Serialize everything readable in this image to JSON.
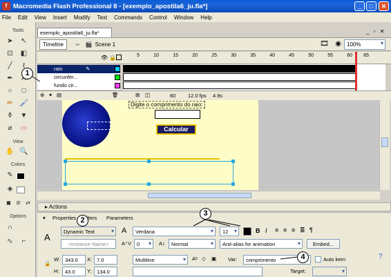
{
  "window": {
    "title": "Macromedia Flash Professional 8 - [exemplo_apostila6_ju.fla*]",
    "min": "_",
    "max": "□",
    "close": "✕"
  },
  "menu": [
    "File",
    "Edit",
    "View",
    "Insert",
    "Modify",
    "Text",
    "Commands",
    "Control",
    "Window",
    "Help"
  ],
  "tools": {
    "title": "Tools",
    "view": "View",
    "colors": "Colors",
    "options": "Options"
  },
  "doc": {
    "tab": "exemplo_apostila6_ju.fla*",
    "timeline_btn": "Timeline",
    "scene": "Scene 1",
    "zoom": "100%"
  },
  "timeline": {
    "frame_numbers": [
      "5",
      "10",
      "15",
      "20",
      "25",
      "30",
      "35",
      "40",
      "45",
      "50",
      "55",
      "60",
      "65"
    ],
    "layers": [
      {
        "name": "raio"
      },
      {
        "name": "circunfer..."
      },
      {
        "name": "fundo cir..."
      }
    ],
    "frame": "60",
    "fps": "12.0 fps",
    "time": "4.9s"
  },
  "stage": {
    "prompt": "Digite o comprimento do raio:",
    "button": "Calcular"
  },
  "panels": {
    "actions": "Actions",
    "tab_properties": "Properties",
    "tab_filters": "Filters",
    "tab_parameters": "Parameters"
  },
  "props": {
    "text_type": "Dynamic Text",
    "instance_name": "<Instance Name>",
    "font": "Verdana",
    "size": "12",
    "bold": "B",
    "italic": "I",
    "spacing": "0",
    "position": "Normal",
    "anti_alias": "Anti-alias for animation",
    "embed": "Embed...",
    "w_label": "W:",
    "w": "343.0",
    "x_label": "X:",
    "x": "7.0",
    "h_label": "H:",
    "h": "43.0",
    "y_label": "Y:",
    "y": "134.0",
    "line_type": "Multiline",
    "var_label": "Var:",
    "var": "comprimento",
    "auto_kern": "Auto kern",
    "target_label": "Target:"
  },
  "callouts": [
    "1",
    "2",
    "3",
    "4"
  ],
  "colors": {
    "title_bar": "#0a5cd6",
    "stage": "#fefdc8",
    "layer_selected": "#0a246a",
    "button_bg": "#1a1a5e",
    "button_border": "#e8c000"
  }
}
